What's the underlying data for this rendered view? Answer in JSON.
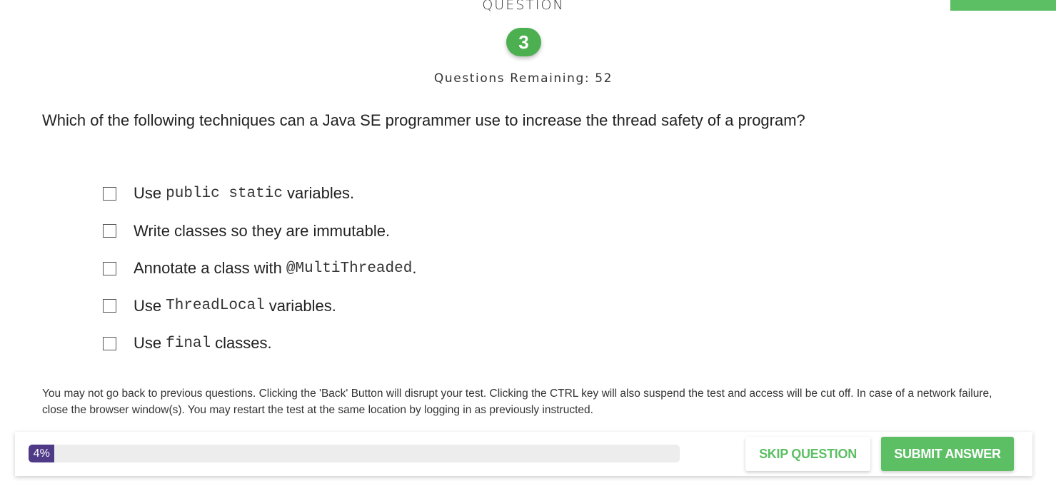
{
  "header": {
    "title": "QUESTION",
    "number": "3",
    "remaining": "Questions Remaining: 52"
  },
  "question": "Which of the following techniques can a Java SE programmer use to increase the thread safety of a program?",
  "options": [
    {
      "pre": "Use",
      "code": "public static",
      "post": "variables.",
      "checked": false
    },
    {
      "pre": "Write classes so they are immutable.",
      "code": "",
      "post": "",
      "checked": false
    },
    {
      "pre": "Annotate a class with",
      "code": "@MultiThreaded",
      "post": ".",
      "checked": false
    },
    {
      "pre": "Use",
      "code": "ThreadLocal",
      "post": "variables.",
      "checked": false
    },
    {
      "pre": "Use",
      "code": "final",
      "post": "classes.",
      "checked": false
    }
  ],
  "notice": "You may not go back to previous questions. Clicking the 'Back' Button will disrupt your test. Clicking the CTRL key will also suspend the test and access will be cut off. In case of a network failure, close the browser window(s). You may restart the test at the same location by logging in as previously instructed.",
  "footer": {
    "progress_percent": 4,
    "progress_label": "4%",
    "skip_label": "SKIP QUESTION",
    "submit_label": "SUBMIT ANSWER"
  },
  "colors": {
    "accent": "#5cbf63",
    "badge": "#4caf50",
    "progress": "#4e3a86"
  }
}
